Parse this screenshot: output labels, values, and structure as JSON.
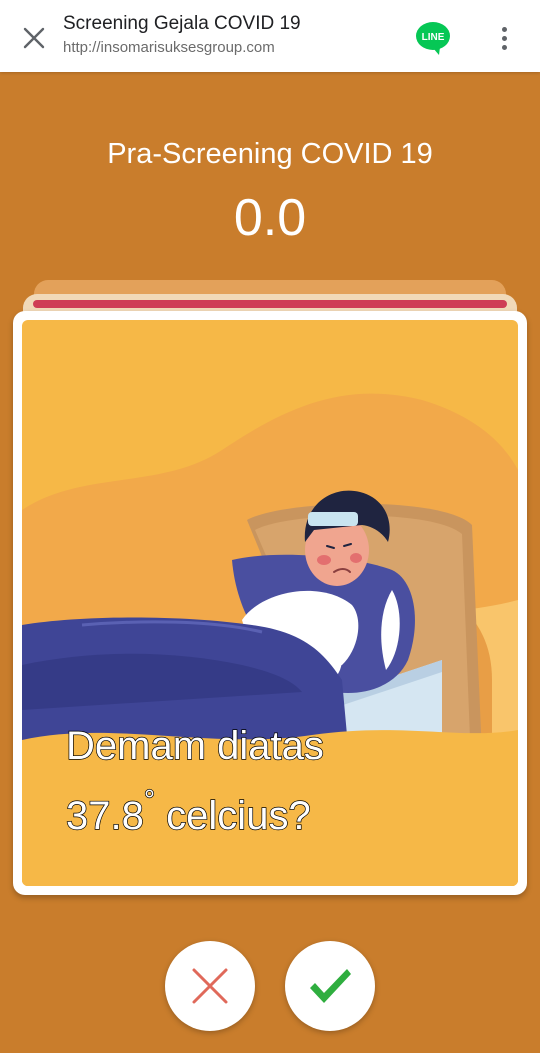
{
  "browser": {
    "title": "Screening Gejala COVID 19",
    "url": "http://insomarisuksesgroup.com",
    "line_label": "LINE",
    "icons": [
      "close-icon",
      "line-app-icon",
      "more-vert-icon"
    ]
  },
  "screen": {
    "heading": "Pra-Screening COVID 19",
    "score": "0.0"
  },
  "card": {
    "question_line1": "Demam diatas",
    "question_value": "37.8",
    "question_degree": "°",
    "question_unit": " celcius?"
  },
  "answers": {
    "no_icon": "cross-icon",
    "yes_icon": "check-icon"
  },
  "colors": {
    "background": "#c97d2c",
    "card_fill": "#f6b847",
    "blanket": "#3f4596",
    "no_color": "#e0695a",
    "yes_color": "#2fae3f",
    "line_green": "#06c755"
  }
}
